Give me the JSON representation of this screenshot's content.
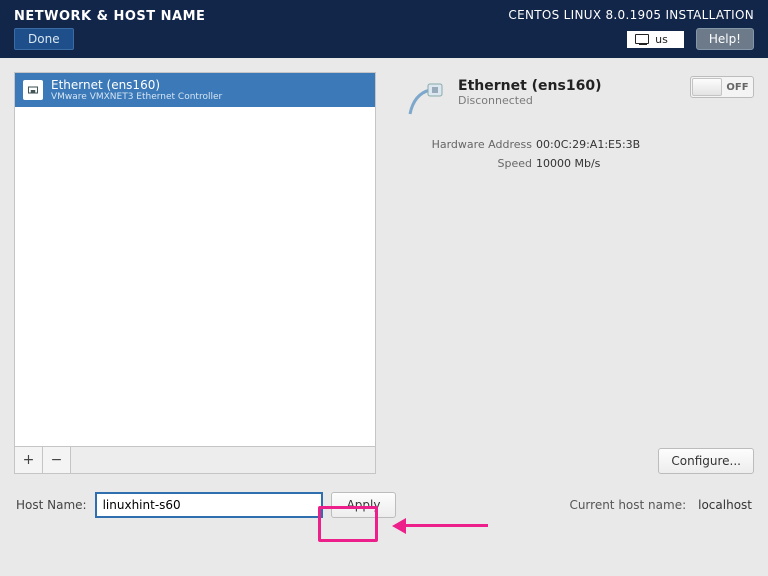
{
  "header": {
    "title": "NETWORK & HOST NAME",
    "done": "Done",
    "install_title": "CENTOS LINUX 8.0.1905 INSTALLATION",
    "keyboard": "us",
    "help": "Help!"
  },
  "device_list": {
    "items": [
      {
        "name": "Ethernet (ens160)",
        "sub": "VMware VMXNET3 Ethernet Controller"
      }
    ],
    "add": "+",
    "remove": "−"
  },
  "connection": {
    "name": "Ethernet (ens160)",
    "status": "Disconnected",
    "toggle_state": "OFF",
    "rows": [
      {
        "label": "Hardware Address",
        "value": "00:0C:29:A1:E5:3B"
      },
      {
        "label": "Speed",
        "value": "10000 Mb/s"
      }
    ],
    "configure": "Configure..."
  },
  "hostname": {
    "label": "Host Name:",
    "value": "linuxhint-s60",
    "apply": "Apply",
    "current_label": "Current host name:",
    "current_value": "localhost"
  }
}
